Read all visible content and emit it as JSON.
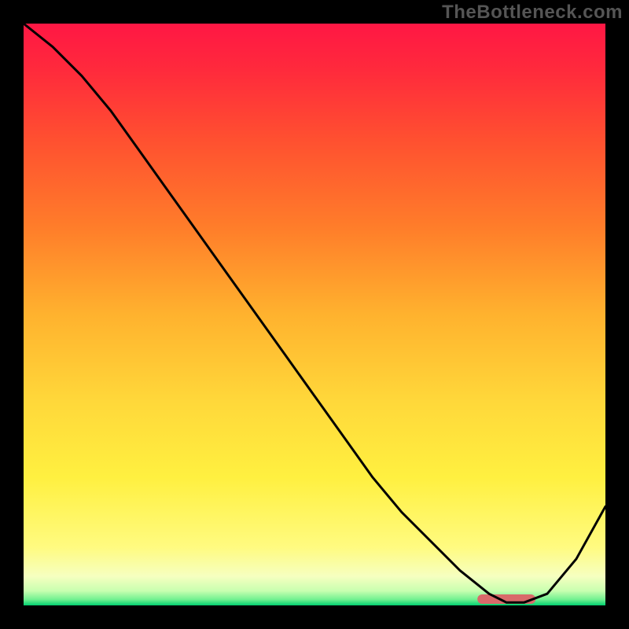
{
  "watermark": "TheBottleneck.com",
  "chart_data": {
    "type": "line",
    "title": "",
    "xlabel": "",
    "ylabel": "",
    "xlim": [
      0,
      100
    ],
    "ylim": [
      0,
      100
    ],
    "x": [
      0,
      5,
      10,
      15,
      20,
      25,
      30,
      35,
      40,
      45,
      50,
      55,
      60,
      65,
      70,
      75,
      80,
      83,
      86,
      90,
      95,
      100
    ],
    "values": [
      100,
      96,
      91,
      85,
      78,
      71,
      64,
      57,
      50,
      43,
      36,
      29,
      22,
      16,
      11,
      6,
      2,
      0.5,
      0.5,
      2,
      8,
      17
    ],
    "optimal_marker": {
      "x_start": 78,
      "x_end": 88,
      "y": 0
    },
    "background_gradient": {
      "stops": [
        {
          "offset": 0.0,
          "color": "#ff1744"
        },
        {
          "offset": 0.08,
          "color": "#ff2a3c"
        },
        {
          "offset": 0.2,
          "color": "#ff5030"
        },
        {
          "offset": 0.35,
          "color": "#ff7d2a"
        },
        {
          "offset": 0.5,
          "color": "#ffb22e"
        },
        {
          "offset": 0.65,
          "color": "#ffd83a"
        },
        {
          "offset": 0.78,
          "color": "#fff040"
        },
        {
          "offset": 0.9,
          "color": "#fffb80"
        },
        {
          "offset": 0.95,
          "color": "#f6ffc0"
        },
        {
          "offset": 0.975,
          "color": "#c8ffb0"
        },
        {
          "offset": 0.99,
          "color": "#70f090"
        },
        {
          "offset": 1.0,
          "color": "#00d070"
        }
      ]
    }
  }
}
